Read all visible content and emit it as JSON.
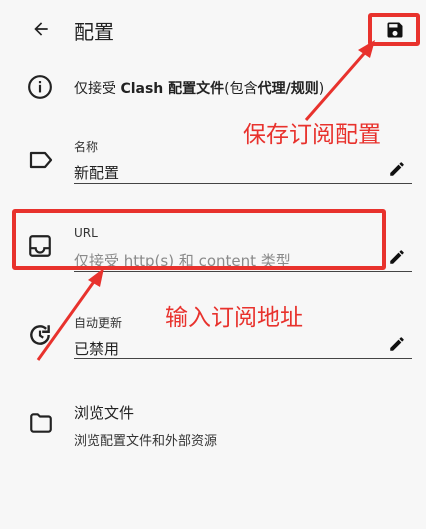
{
  "header": {
    "title": "配置",
    "back_icon": "arrow-left-icon",
    "save_icon": "save-icon"
  },
  "info": {
    "prefix": "仅接受 ",
    "bold1": "Clash 配置文件",
    "mid": "(包含",
    "bold2": "代理/规则",
    "suffix": ")"
  },
  "name_field": {
    "label": "名称",
    "value": "新配置",
    "icon": "label-icon"
  },
  "url_field": {
    "label": "URL",
    "placeholder": "仅接受 http(s) 和 content 类型",
    "icon": "inbox-icon"
  },
  "auto_update_field": {
    "label": "自动更新",
    "value": "已禁用",
    "icon": "update-icon"
  },
  "browse": {
    "title": "浏览文件",
    "subtitle": "浏览配置文件和外部资源",
    "icon": "folder-icon"
  },
  "annotations": {
    "save_note": "保存订阅配置",
    "url_note": "输入订阅地址",
    "color": "#e8322d"
  }
}
